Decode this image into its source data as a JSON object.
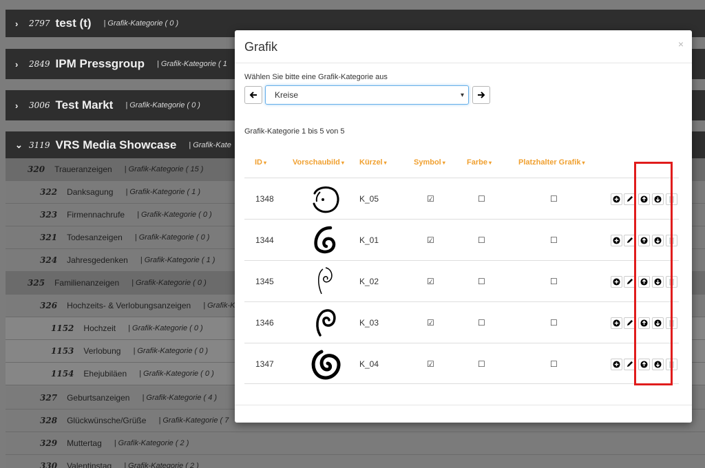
{
  "background": {
    "categories": [
      {
        "id": "2797",
        "name": "test (t)",
        "count": "| Grafik-Kategorie ( 0 )",
        "expanded_icon": "chevron-right-icon"
      },
      {
        "id": "2849",
        "name": "IPM Pressgroup",
        "count": "| Grafik-Kategorie ( 1",
        "expanded_icon": "chevron-right-icon"
      },
      {
        "id": "3006",
        "name": "Test Markt",
        "count": "| Grafik-Kategorie ( 0 )",
        "expanded_icon": "chevron-right-icon"
      },
      {
        "id": "3119",
        "name": "VRS Media Showcase",
        "count": "| Grafik-Kate",
        "expanded_icon": "chevron-down-icon"
      }
    ],
    "subrows": [
      {
        "id": "320",
        "name": "Traueranzeigen",
        "count": "| Grafik-Kategorie ( 15 )"
      },
      {
        "id": "322",
        "name": "Danksagung",
        "count": "| Grafik-Kategorie ( 1 )"
      },
      {
        "id": "323",
        "name": "Firmennachrufe",
        "count": "| Grafik-Kategorie ( 0 )"
      },
      {
        "id": "321",
        "name": "Todesanzeigen",
        "count": "| Grafik-Kategorie ( 0 )"
      },
      {
        "id": "324",
        "name": "Jahresgedenken",
        "count": "| Grafik-Kategorie ( 1 )"
      },
      {
        "id": "325",
        "name": "Familienanzeigen",
        "count": "| Grafik-Kategorie ( 0 )"
      },
      {
        "id": "326",
        "name": "Hochzeits- & Verlobungsanzeigen",
        "count": "| Grafik-K"
      },
      {
        "id": "1152",
        "name": "Hochzeit",
        "count": "| Grafik-Kategorie ( 0 )"
      },
      {
        "id": "1153",
        "name": "Verlobung",
        "count": "| Grafik-Kategorie ( 0 )"
      },
      {
        "id": "1154",
        "name": "Ehejubiläen",
        "count": "| Grafik-Kategorie ( 0 )"
      },
      {
        "id": "327",
        "name": "Geburtsanzeigen",
        "count": "| Grafik-Kategorie ( 4 )"
      },
      {
        "id": "328",
        "name": "Glückwünsche/Grüße",
        "count": "| Grafik-Kategorie ( 7"
      },
      {
        "id": "329",
        "name": "Muttertag",
        "count": "| Grafik-Kategorie ( 2 )"
      },
      {
        "id": "330",
        "name": "Valentinstag",
        "count": "| Grafik-Kategorie ( 2 )"
      }
    ]
  },
  "modal": {
    "title": "Grafik",
    "close_label": "×",
    "select_label": "Wählen Sie bitte eine Grafik-Kategorie aus",
    "select_value": "Kreise",
    "prev_label": "🡐",
    "next_label": "🡒",
    "count_text": "Grafik-Kategorie 1 bis 5 von 5",
    "columns": {
      "id": "ID",
      "preview": "Vorschaubild",
      "short": "Kürzel",
      "symbol": "Symbol",
      "color": "Farbe",
      "placeholder": "Platzhalter Grafik"
    },
    "rows": [
      {
        "id": "1348",
        "short": "K_05",
        "symbol": "☑",
        "color": "☐",
        "placeholder": "☐",
        "preview_icon": "broken-circle-icon"
      },
      {
        "id": "1344",
        "short": "K_01",
        "symbol": "☑",
        "color": "☐",
        "placeholder": "☐",
        "preview_icon": "spiral-icon"
      },
      {
        "id": "1345",
        "short": "K_02",
        "symbol": "☑",
        "color": "☐",
        "placeholder": "☐",
        "preview_icon": "thin-spiral-icon"
      },
      {
        "id": "1346",
        "short": "K_03",
        "symbol": "☑",
        "color": "☐",
        "placeholder": "☐",
        "preview_icon": "loop-spiral-icon"
      },
      {
        "id": "1347",
        "short": "K_04",
        "symbol": "☑",
        "color": "☐",
        "placeholder": "☐",
        "preview_icon": "bold-spiral-icon"
      }
    ],
    "actions": [
      "add-icon",
      "pencil-icon",
      "arrow-up-circle-icon",
      "arrow-down-circle-icon",
      "trash-icon"
    ]
  },
  "colors": {
    "header_orange": "#f0a030",
    "highlight_red": "#e01c1c",
    "category_bar": "#2e2e2e"
  }
}
